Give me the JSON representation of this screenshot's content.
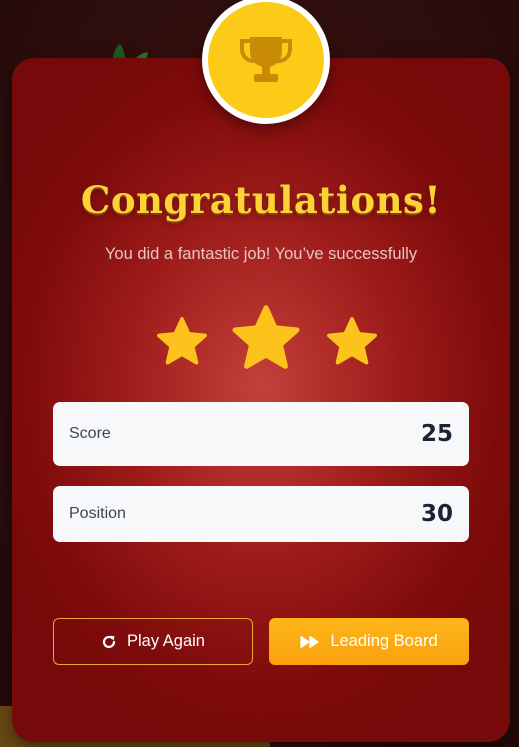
{
  "colors": {
    "card_red": "#8a0f0f",
    "accent_gold": "#fbcb17",
    "title_gold": "#fdd235",
    "primary_button": "#fbab14",
    "outline_button_border": "#e9a636",
    "stat_box_bg": "#f7f8fa"
  },
  "icons": {
    "badge": "trophy-icon",
    "play_again": "refresh-icon",
    "leading_board": "fast-forward-icon",
    "rating": "star-icon"
  },
  "result": {
    "title": "Congratulations!",
    "message": "You did a fantastic job! You’ve successfully",
    "stars_earned": 3,
    "stars_total": 3
  },
  "stats": [
    {
      "label": "Score",
      "value": "25"
    },
    {
      "label": "Position",
      "value": "30"
    }
  ],
  "actions": {
    "play_again_label": "Play Again",
    "leading_board_label": "Leading Board"
  }
}
